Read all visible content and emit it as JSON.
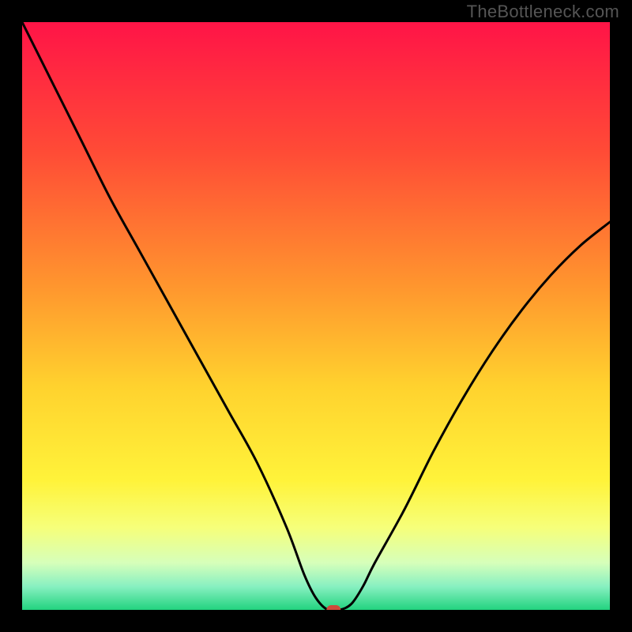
{
  "watermark": "TheBottleneck.com",
  "chart_data": {
    "type": "line",
    "title": "",
    "xlabel": "",
    "ylabel": "",
    "xlim": [
      0,
      100
    ],
    "ylim": [
      0,
      100
    ],
    "x": [
      0,
      5,
      10,
      15,
      20,
      25,
      30,
      35,
      40,
      45,
      48,
      50,
      52,
      54,
      56,
      58,
      60,
      65,
      70,
      75,
      80,
      85,
      90,
      95,
      100
    ],
    "y": [
      100,
      90,
      80,
      70,
      61,
      52,
      43,
      34,
      25,
      14,
      6,
      2,
      0,
      0,
      1,
      4,
      8,
      17,
      27,
      36,
      44,
      51,
      57,
      62,
      66
    ],
    "marker": {
      "x": 53,
      "y": 0
    },
    "gradient_stops": [
      {
        "offset": 0.0,
        "color": "#ff1447"
      },
      {
        "offset": 0.22,
        "color": "#ff4b36"
      },
      {
        "offset": 0.45,
        "color": "#ff962e"
      },
      {
        "offset": 0.62,
        "color": "#ffd22e"
      },
      {
        "offset": 0.78,
        "color": "#fff33a"
      },
      {
        "offset": 0.86,
        "color": "#f6ff7a"
      },
      {
        "offset": 0.92,
        "color": "#d6ffba"
      },
      {
        "offset": 0.96,
        "color": "#88f0c1"
      },
      {
        "offset": 1.0,
        "color": "#22d37f"
      }
    ],
    "series": [
      {
        "name": "bottleneck-curve",
        "x_key": "x",
        "y_key": "y"
      }
    ]
  }
}
